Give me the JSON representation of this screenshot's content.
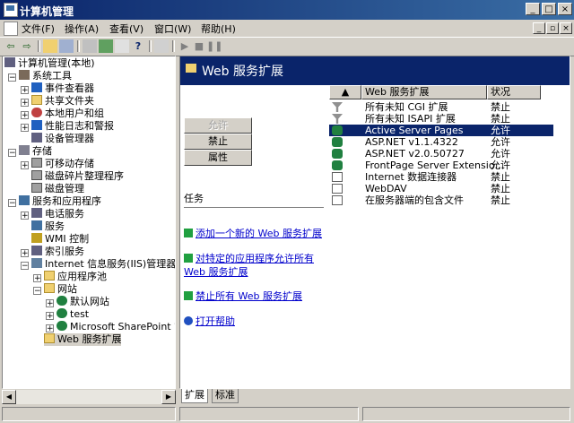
{
  "window": {
    "title": "计算机管理",
    "buttons": [
      "_",
      "□",
      "×"
    ]
  },
  "menu": {
    "items": [
      "文件(F)",
      "操作(A)",
      "查看(V)",
      "窗口(W)",
      "帮助(H)"
    ]
  },
  "mdi_buttons": [
    "_",
    "▫",
    "×"
  ],
  "tree": {
    "nodes": [
      {
        "label": "计算机管理(本地)",
        "icon": "computer-management-icon"
      },
      {
        "label": "系统工具",
        "icon": "system-tools-icon"
      },
      {
        "label": "事件查看器",
        "icon": "event-viewer-icon"
      },
      {
        "label": "共享文件夹",
        "icon": "shared-folders-icon"
      },
      {
        "label": "本地用户和组",
        "icon": "local-users-icon"
      },
      {
        "label": "性能日志和警报",
        "icon": "performance-logs-icon"
      },
      {
        "label": "设备管理器",
        "icon": "device-manager-icon"
      },
      {
        "label": "存储",
        "icon": "storage-icon"
      },
      {
        "label": "可移动存储",
        "icon": "removable-storage-icon"
      },
      {
        "label": "磁盘碎片整理程序",
        "icon": "defrag-icon"
      },
      {
        "label": "磁盘管理",
        "icon": "disk-management-icon"
      },
      {
        "label": "服务和应用程序",
        "icon": "services-apps-icon"
      },
      {
        "label": "电话服务",
        "icon": "telephony-icon"
      },
      {
        "label": "服务",
        "icon": "services-icon"
      },
      {
        "label": "WMI 控制",
        "icon": "wmi-icon"
      },
      {
        "label": "索引服务",
        "icon": "indexing-icon"
      },
      {
        "label": "Internet 信息服务(IIS)管理器",
        "icon": "iis-icon"
      },
      {
        "label": "应用程序池",
        "icon": "folder-icon"
      },
      {
        "label": "网站",
        "icon": "folder-icon"
      },
      {
        "label": "默认网站",
        "icon": "globe-icon"
      },
      {
        "label": "test",
        "icon": "globe-icon"
      },
      {
        "label": "Microsoft SharePoint 管理",
        "icon": "globe-icon"
      },
      {
        "label": "Web 服务扩展",
        "icon": "folder-icon"
      }
    ]
  },
  "panel": {
    "title": "Web 服务扩展",
    "buttons": {
      "allow": "允许",
      "prohibit": "禁止",
      "properties": "属性"
    },
    "tasks_label": "任务",
    "links": [
      "添加一个新的 Web 服务扩展",
      "对特定的应用程序允许所有 Web 服务扩展",
      "禁止所有 Web 服务扩展",
      "打开帮助"
    ]
  },
  "list": {
    "columns": [
      "Web 服务扩展",
      "状况"
    ],
    "sort_indicator": "▲",
    "rows": [
      {
        "name": "所有未知 CGI 扩展",
        "status": "禁止",
        "icon": "filter-icon"
      },
      {
        "name": "所有未知 ISAPI 扩展",
        "status": "禁止",
        "icon": "filter-icon"
      },
      {
        "name": "Active Server Pages",
        "status": "允许",
        "icon": "extension-allowed-icon",
        "selected": true
      },
      {
        "name": "ASP.NET v1.1.4322",
        "status": "允许",
        "icon": "extension-allowed-icon"
      },
      {
        "name": "ASP.NET v2.0.50727",
        "status": "允许",
        "icon": "extension-allowed-icon"
      },
      {
        "name": "FrontPage Server Extensio...",
        "status": "允许",
        "icon": "extension-allowed-icon"
      },
      {
        "name": "Internet 数据连接器",
        "status": "禁止",
        "icon": "extension-prohibited-icon"
      },
      {
        "name": "WebDAV",
        "status": "禁止",
        "icon": "extension-prohibited-icon"
      },
      {
        "name": "在服务器端的包含文件",
        "status": "禁止",
        "icon": "extension-prohibited-icon"
      }
    ]
  },
  "tabs": [
    "扩展",
    "标准"
  ]
}
